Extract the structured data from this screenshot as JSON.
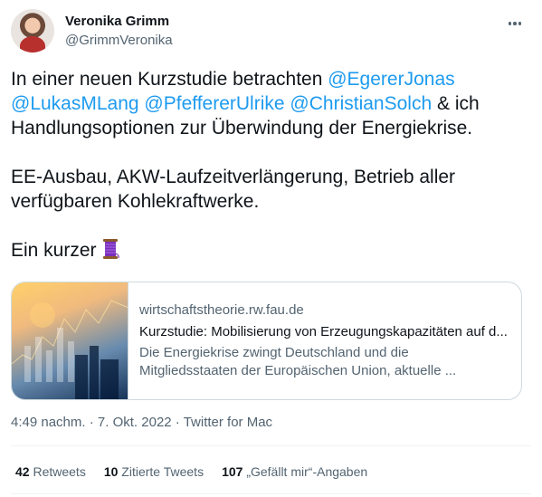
{
  "author": {
    "name": "Veronika Grimm",
    "handle": "@GrimmVeronika"
  },
  "tweet": {
    "line1_text": "In einer neuen Kurzstudie betrachten ",
    "mentions": [
      "@EgererJonas",
      "@LukasMLang",
      "@PfeffererUlrike",
      "@ChristianSolch"
    ],
    "line2_tail": " & ich",
    "line3": "Handlungsoptionen zur Überwindung der Energiekrise.",
    "para2_line1": "EE-Ausbau, AKW-Laufzeitverlängerung, Betrieb aller",
    "para2_line2": "verfügbaren Kohlekraftwerke.",
    "para3": "Ein kurzer",
    "emoji": "thread-spool-icon"
  },
  "card": {
    "domain": "wirtschaftstheorie.rw.fau.de",
    "title": "Kurzstudie: Mobilisierung von Erzeugungskapazitäten auf d...",
    "desc_line1": "Die Energiekrise zwingt Deutschland und die",
    "desc_line2": "Mitgliedsstaaten der Europäischen Union, aktuelle ..."
  },
  "meta": {
    "time": "4:49 nachm.",
    "sep1": " · ",
    "date": "7. Okt. 2022",
    "sep2": " · ",
    "source": "Twitter for Mac"
  },
  "stats": {
    "retweets_count": "42",
    "retweets_label": " Retweets",
    "quotes_count": "10",
    "quotes_label": " Zitierte Tweets",
    "likes_count": "107",
    "likes_label": " „Gefällt mir“-Angaben"
  },
  "colors": {
    "accent": "#1d9bf0",
    "text": "#0f1419",
    "secondary": "#536471",
    "border": "#cfd9de"
  }
}
